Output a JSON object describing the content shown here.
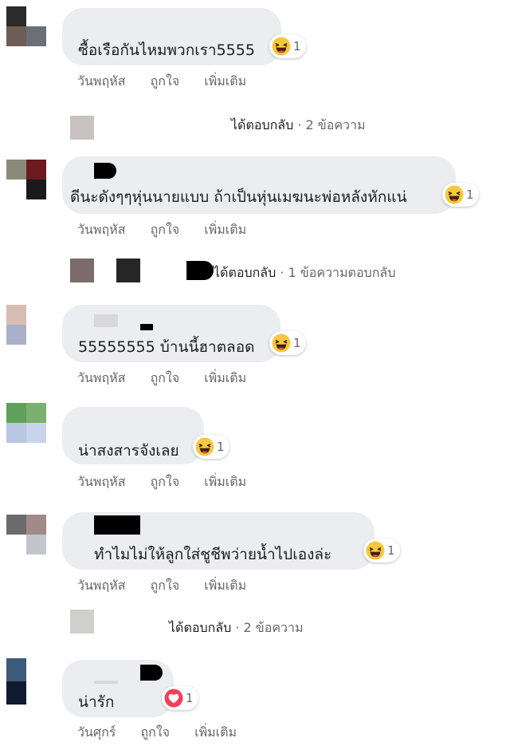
{
  "comments": [
    {
      "text": "ซื้อเรือกันไหมพวกเรา5555",
      "reaction_count": "1",
      "day": "วันพฤหัส",
      "like": "ถูกใจ",
      "more": "เพิ่มเติม"
    },
    {
      "text": "ดีนะดังๆๆหุ่นนายแบบ ถ้าเป็นหุ่นเมฆนะพ่อหลังหักแน่",
      "reaction_count": "1",
      "day": "วันพฤหัส",
      "like": "ถูกใจ",
      "more": "เพิ่มเติม"
    },
    {
      "text": "55555555 บ้านนี้ฮาตลอด",
      "reaction_count": "1",
      "day": "วันพฤหัส",
      "like": "ถูกใจ",
      "more": "เพิ่มเติม"
    },
    {
      "text": "น่าสงสารจังเลย",
      "reaction_count": "1",
      "day": "วันพฤหัส",
      "like": "ถูกใจ",
      "more": "เพิ่มเติม"
    },
    {
      "text": "ทำไมไม่ให้ลูกใส่ชูชีพว่ายน้ำไปเองล่ะ",
      "reaction_count": "1",
      "day": "วันพฤหัส",
      "like": "ถูกใจ",
      "more": "เพิ่มเติม"
    },
    {
      "text": "น่ารัก",
      "reaction_count": "1",
      "day": "วันศุกร์",
      "like": "ถูกใจ",
      "more": "เพิ่มเติม"
    }
  ],
  "replies": [
    {
      "label": "ได้ตอบกลับ",
      "meta": "· 2 ข้อความ"
    },
    {
      "label": "ได้ตอบกลับ",
      "meta": "· 1 ข้อความตอบกลับ"
    },
    {
      "label": "ได้ตอบกลับ",
      "meta": "· 2 ข้อความ"
    }
  ],
  "colors": {
    "bubble": "#ebedf0",
    "secondary_text": "#65676b",
    "haha_yellow": "#f7c83b",
    "love_red": "#f33e58"
  },
  "icons": {
    "haha": "laughing-face-reaction",
    "love": "heart-reaction"
  }
}
